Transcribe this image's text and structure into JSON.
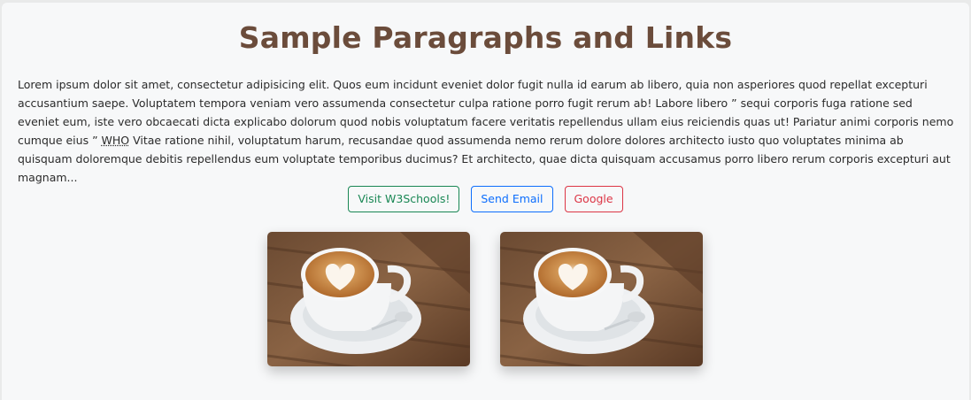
{
  "page": {
    "title": "Sample Paragraphs and Links",
    "paragraph_before_abbr": "Lorem ipsum dolor sit amet, consectetur adipisicing elit. Quos eum incidunt eveniet dolor fugit nulla id earum ab libero, quia non asperiores quod repellat excepturi accusantium saepe. Voluptatem tempora veniam vero assumenda consectetur culpa ratione porro fugit rerum ab! Labore libero ” sequi corporis fuga ratione sed eveniet eum, iste vero obcaecati dicta explicabo dolorum quod nobis voluptatum facere veritatis repellendus ullam eius reiciendis quas ut! Pariatur animi corporis nemo cumque eius ” ",
    "abbr": "WHO",
    "paragraph_after_abbr": " Vitae ratione nihil, voluptatum harum, recusandae quod assumenda nemo rerum dolore dolores architecto iusto quo voluptates minima ab quisquam doloremque debitis repellendus eum voluptate temporibus ducimus? Et architecto, quae dicta quisquam accusamus porro libero rerum corporis excepturi aut magnam..."
  },
  "buttons": [
    {
      "label": "Visit W3Schools!"
    },
    {
      "label": "Send Email"
    },
    {
      "label": "Google"
    }
  ],
  "images": [
    {
      "icon": "coffee-latte-art-photo"
    },
    {
      "icon": "coffee-latte-art-photo"
    }
  ],
  "colors": {
    "title": "#6b4c3b",
    "btn_green": "#198754",
    "btn_blue": "#0d6efd",
    "btn_red": "#dc3545"
  }
}
